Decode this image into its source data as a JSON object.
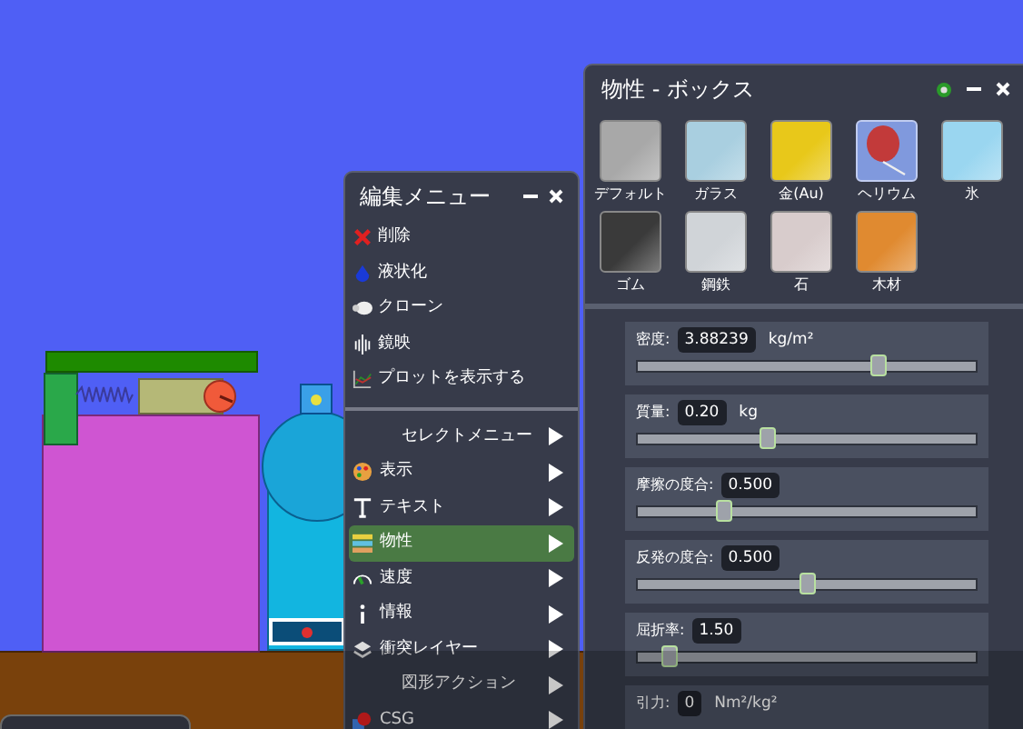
{
  "edit_menu": {
    "title": "編集メニュー",
    "actions": [
      {
        "label": "削除"
      },
      {
        "label": "液状化"
      },
      {
        "label": "クローン"
      },
      {
        "label": "鏡映"
      },
      {
        "label": "プロットを表示する"
      }
    ],
    "submenus": [
      {
        "label": "セレクトメニュー",
        "selected": false
      },
      {
        "label": "表示",
        "selected": false
      },
      {
        "label": "テキスト",
        "selected": false
      },
      {
        "label": "物性",
        "selected": true
      },
      {
        "label": "速度",
        "selected": false
      },
      {
        "label": "情報",
        "selected": false
      },
      {
        "label": "衝突レイヤー",
        "selected": false
      },
      {
        "label": "図形アクション",
        "selected": false
      },
      {
        "label": "CSG",
        "selected": false
      }
    ]
  },
  "properties_panel": {
    "title": "物性 - ボックス",
    "materials": [
      {
        "label": "デフォルト",
        "color": "#a8a8a8",
        "selected": false
      },
      {
        "label": "ガラス",
        "color": "#a9cfe0",
        "selected": false
      },
      {
        "label": "金(Au)",
        "color": "#e8c81a",
        "selected": false
      },
      {
        "label": "ヘリウム",
        "color": "#c23a3a",
        "selected": true
      },
      {
        "label": "氷",
        "color": "#9ad6f0",
        "selected": false
      },
      {
        "label": "ゴム",
        "color": "#3a3a3a",
        "selected": false
      },
      {
        "label": "鋼鉄",
        "color": "#d0d4d8",
        "selected": false
      },
      {
        "label": "石",
        "color": "#d8cccc",
        "selected": false
      },
      {
        "label": "木材",
        "color": "#e08a30",
        "selected": false
      }
    ],
    "properties": [
      {
        "label": "密度:",
        "value": "3.88239",
        "unit": "kg/m²",
        "level": 0.71
      },
      {
        "label": "質量:",
        "value": "0.20",
        "unit": "kg",
        "level": 0.38
      },
      {
        "label": "摩擦の度合:",
        "value": "0.500",
        "level": 0.25
      },
      {
        "label": "反発の度合:",
        "value": "0.500",
        "level": 0.5
      },
      {
        "label": "屈折率:",
        "value": "1.50",
        "level": 0.09
      },
      {
        "label": "引力:",
        "value": "0",
        "unit": "Nm²/kg²"
      }
    ]
  }
}
